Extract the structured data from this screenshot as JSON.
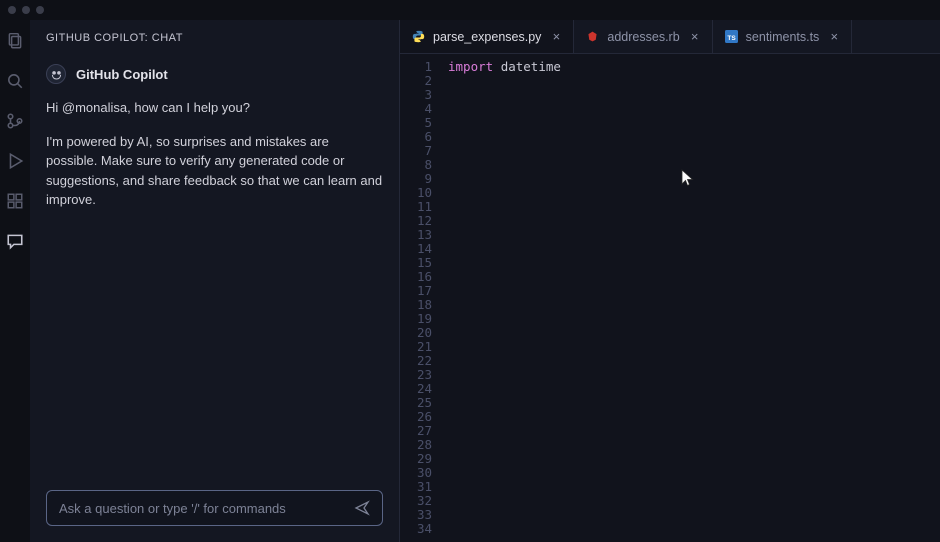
{
  "window": {
    "traffic_lights": 3
  },
  "activitybar": {
    "items": [
      "files",
      "search",
      "branch",
      "debug",
      "extensions",
      "chat"
    ],
    "active": "chat"
  },
  "sidebar": {
    "title": "GITHUB COPILOT: CHAT",
    "bot_name": "GitHub Copilot",
    "messages": [
      "Hi @monalisa, how can I help you?",
      "I'm powered by AI, so surprises and mistakes are possible. Make sure to verify any generated code or suggestions, and share feedback so that we can learn and improve."
    ],
    "input_placeholder": "Ask a question or type '/' for commands"
  },
  "editor": {
    "tabs": [
      {
        "file": "parse_expenses.py",
        "lang": "python",
        "active": true
      },
      {
        "file": "addresses.rb",
        "lang": "ruby",
        "active": false
      },
      {
        "file": "sentiments.ts",
        "lang": "ts",
        "active": false
      }
    ],
    "line_count": 34,
    "lines": [
      {
        "tokens": [
          {
            "t": "import",
            "c": "kw"
          },
          {
            "t": " ",
            "c": ""
          },
          {
            "t": "datetime",
            "c": "id"
          }
        ]
      }
    ]
  }
}
